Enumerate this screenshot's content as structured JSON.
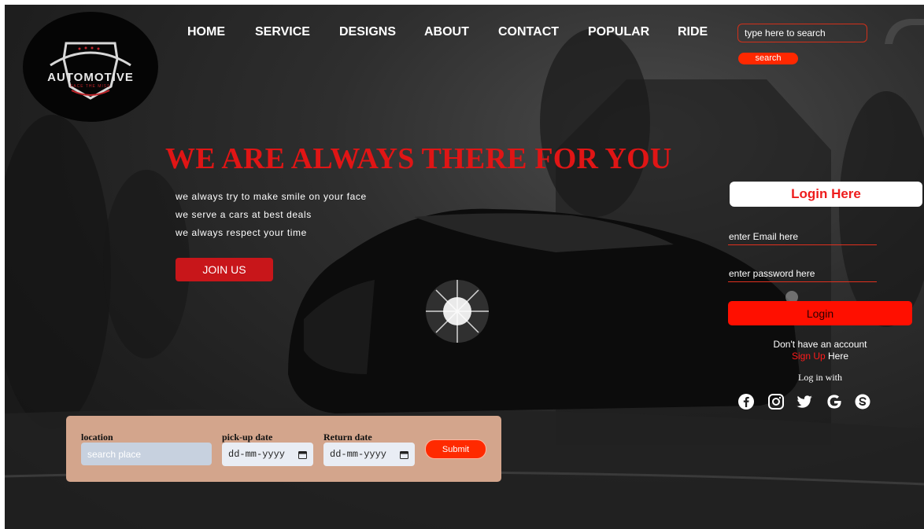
{
  "logo": {
    "name": "AUTOMOTIVE",
    "tagline": "FACE THE MISS"
  },
  "nav": {
    "items": [
      "HOME",
      "SERVICE",
      "DESIGNS",
      "ABOUT",
      "CONTACT",
      "POPULAR",
      "RIDE"
    ]
  },
  "search": {
    "placeholder": "type here to search",
    "button_label": "search"
  },
  "hero": {
    "title": "WE ARE ALWAYS THERE FOR YOU",
    "taglines": [
      "we always try to make smile on your face",
      "we serve a cars at best deals",
      "we always respect your time"
    ],
    "join_label": "JOIN US"
  },
  "login": {
    "header": "Login Here",
    "email_placeholder": "enter Email here",
    "password_placeholder": "enter password here",
    "button_label": "Login",
    "no_account": "Don't have an account",
    "signup_label": "Sign Up",
    "signup_suffix": " Here",
    "login_with": "Log in with",
    "socials": [
      "facebook-icon",
      "instagram-icon",
      "twitter-icon",
      "google-icon",
      "skype-icon"
    ]
  },
  "booking": {
    "location_label": "location",
    "location_placeholder": "search place",
    "pickup_label": "pick-up date",
    "pickup_value": "dd-mm-yyyy",
    "return_label": "Return date",
    "return_value": "dd-mm-yyyy",
    "submit_label": "Submit"
  },
  "colors": {
    "accent_red": "#e01515",
    "button_red": "#ff1a00",
    "booking_panel": "#d3a58c"
  }
}
